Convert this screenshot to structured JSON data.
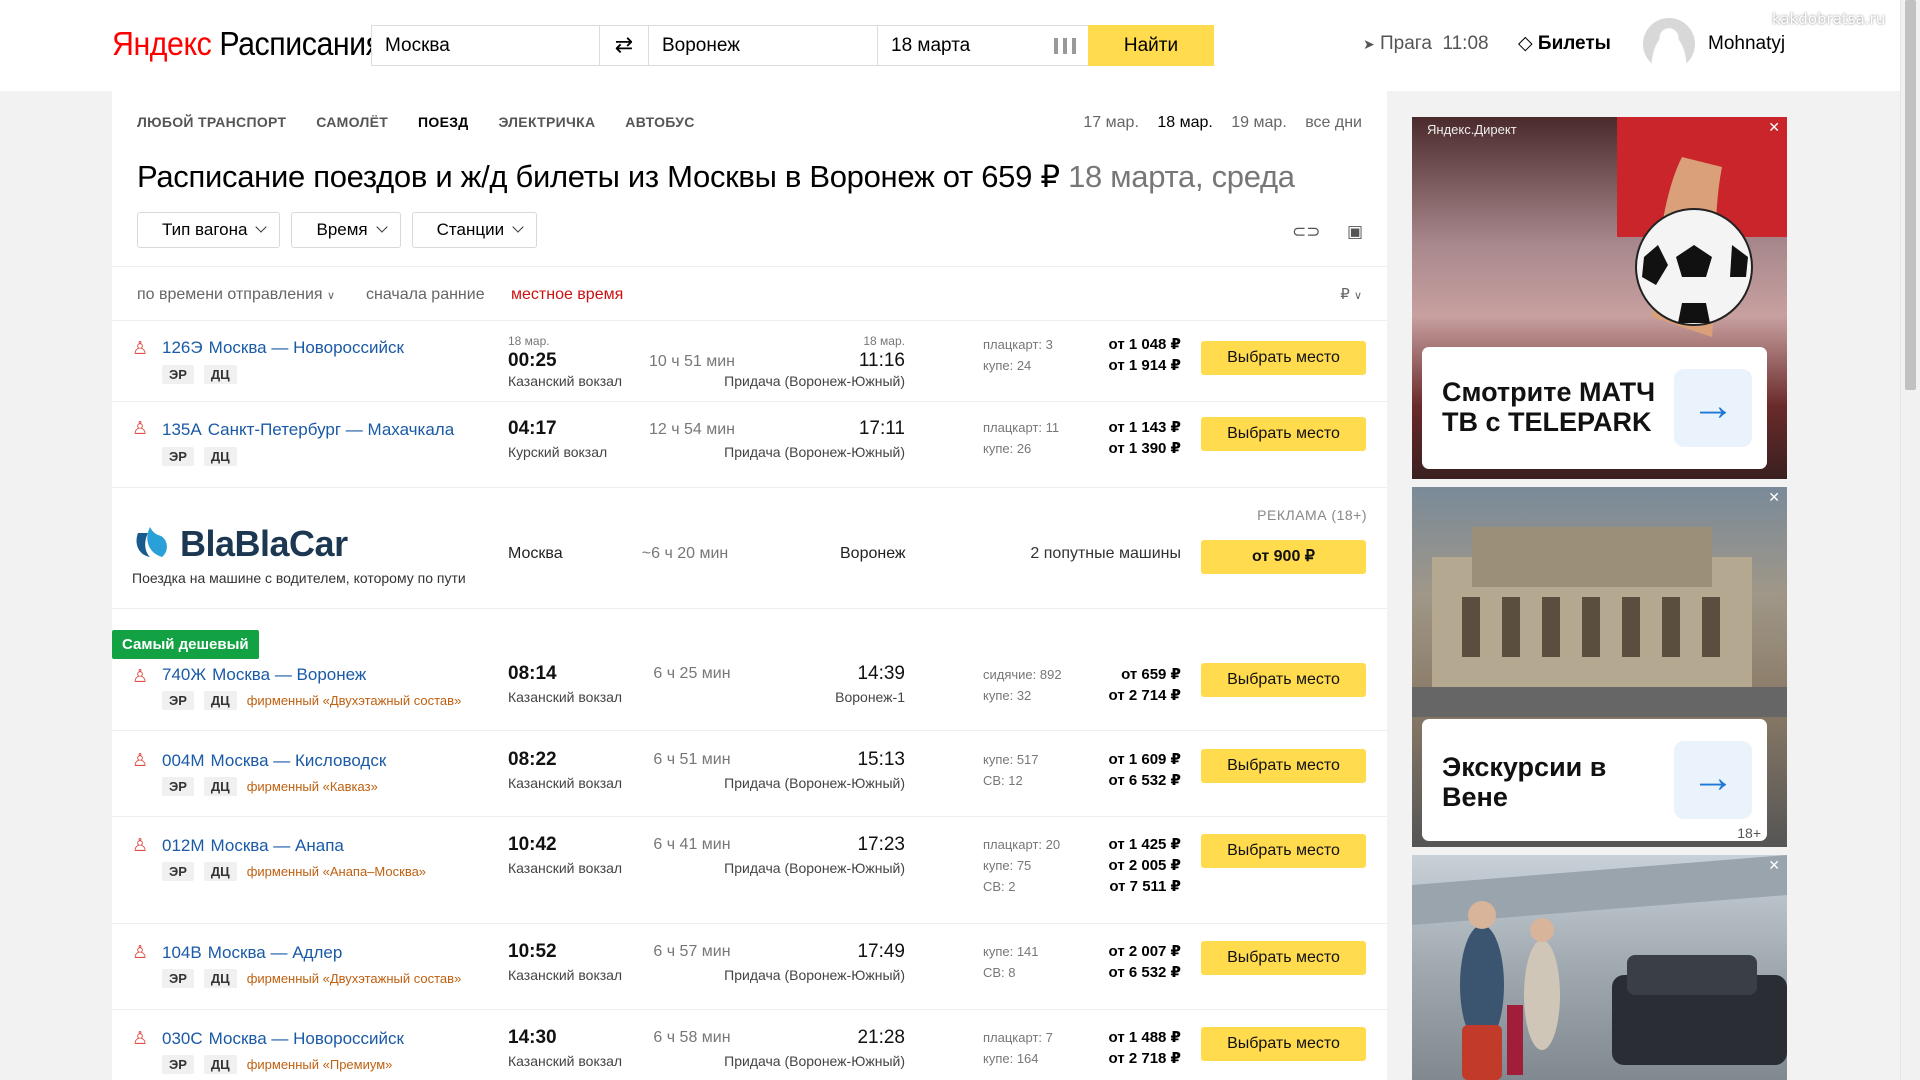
{
  "header": {
    "logo_brand": "Яндекс",
    "logo_service": "Расписания",
    "from_value": "Москва",
    "to_value": "Воронеж",
    "date_value": "18 марта",
    "find_label": "Найти",
    "location": "Прага",
    "time": "11:08",
    "tickets_label": "Билеты",
    "username": "Mohnatyj"
  },
  "watermark": "kakdobratsa.ru",
  "tabs": [
    "ЛЮБОЙ ТРАНСПОРТ",
    "САМОЛЁТ",
    "ПОЕЗД",
    "ЭЛЕКТРИЧКА",
    "АВТОБУС"
  ],
  "active_tab": "ПОЕЗД",
  "dates": [
    "17 мар.",
    "18 мар.",
    "19 мар.",
    "все дни"
  ],
  "title_main": "Расписание поездов и ж/д билеты из Москвы в Воронеж от 659 ₽",
  "title_date": "18 марта, среда",
  "filters": [
    "Тип вагона",
    "Время",
    "Станции"
  ],
  "sort": {
    "by": "по времени отправления",
    "order": "сначала ранние",
    "tz": "местное время",
    "currency": "₽"
  },
  "train_badges": [
    "ЭР",
    "ДЦ"
  ],
  "select_label": "Выбрать место",
  "cheapest_label": "Самый дешевый",
  "trains": [
    {
      "num": "126Э",
      "route": "Москва — Новороссийск",
      "brand": "",
      "dep_date": "18 мар.",
      "dep": "00:25",
      "dep_station": "Казанский вокзал",
      "duration": "10 ч 51 мин",
      "arr_date": "18 мар.",
      "arr": "11:16",
      "arr_station": "Придача (Воронеж-Южный)",
      "classes": [
        "плацкарт: 3",
        "купе: 24"
      ],
      "prices": [
        "от 1 048 ₽",
        "от 1 914 ₽"
      ]
    },
    {
      "num": "135А",
      "route": "Санкт-Петербург — Махачкала",
      "brand": "",
      "dep_date": "",
      "dep": "04:17",
      "dep_station": "Курский вокзал",
      "duration": "12 ч 54 мин",
      "arr_date": "",
      "arr": "17:11",
      "arr_station": "Придача (Воронеж-Южный)",
      "classes": [
        "плацкарт: 11",
        "купе: 26"
      ],
      "prices": [
        "от 1 143 ₽",
        "от 1 390 ₽"
      ]
    },
    {
      "num": "740Ж",
      "route": "Москва — Воронеж",
      "brand": "фирменный «Двухэтажный состав»",
      "dep_date": "",
      "dep": "08:14",
      "dep_station": "Казанский вокзал",
      "duration": "6 ч 25 мин",
      "arr_date": "",
      "arr": "14:39",
      "arr_station": "Воронеж-1",
      "classes": [
        "сидячие: 892",
        "купе: 32"
      ],
      "prices": [
        "от 659 ₽",
        "от 2 714 ₽"
      ]
    },
    {
      "num": "004М",
      "route": "Москва — Кисловодск",
      "brand": "фирменный «Кавказ»",
      "dep_date": "",
      "dep": "08:22",
      "dep_station": "Казанский вокзал",
      "duration": "6 ч 51 мин",
      "arr_date": "",
      "arr": "15:13",
      "arr_station": "Придача (Воронеж-Южный)",
      "classes": [
        "купе: 517",
        "СВ: 12"
      ],
      "prices": [
        "от 1 609 ₽",
        "от 6 532 ₽"
      ]
    },
    {
      "num": "012М",
      "route": "Москва — Анапа",
      "brand": "фирменный «Анапа–Москва»",
      "dep_date": "",
      "dep": "10:42",
      "dep_station": "Казанский вокзал",
      "duration": "6 ч 41 мин",
      "arr_date": "",
      "arr": "17:23",
      "arr_station": "Придача (Воронеж-Южный)",
      "classes": [
        "плацкарт: 20",
        "купе: 75",
        "СВ: 2"
      ],
      "prices": [
        "от 1 425 ₽",
        "от 2 005 ₽",
        "от 7 511 ₽"
      ]
    },
    {
      "num": "104В",
      "route": "Москва — Адлер",
      "brand": "фирменный «Двухэтажный состав»",
      "dep_date": "",
      "dep": "10:52",
      "dep_station": "Казанский вокзал",
      "duration": "6 ч 57 мин",
      "arr_date": "",
      "arr": "17:49",
      "arr_station": "Придача (Воронеж-Южный)",
      "classes": [
        "купе: 141",
        "СВ: 8"
      ],
      "prices": [
        "от 2 007 ₽",
        "от 6 532 ₽"
      ]
    },
    {
      "num": "030С",
      "route": "Москва — Новороссийск",
      "brand": "фирменный «Премиум»",
      "dep_date": "",
      "dep": "14:30",
      "dep_station": "Казанский вокзал",
      "duration": "6 ч 58 мин",
      "arr_date": "",
      "arr": "21:28",
      "arr_station": "Придача (Воронеж-Южный)",
      "classes": [
        "плацкарт: 7",
        "купе: 164"
      ],
      "prices": [
        "от 1 488 ₽",
        "от 2 718 ₽"
      ]
    }
  ],
  "blablacar": {
    "ad_label": "РЕКЛАМА (18+)",
    "logo": "BlaBlaCar",
    "tagline": "Поездка на машине с водителем, которому по пути",
    "from": "Москва",
    "duration": "~6 ч 20 мин",
    "to": "Воронеж",
    "offers": "2 попутные машины",
    "price_label": "от 900 ₽"
  },
  "ads": [
    {
      "label": "Яндекс.Директ",
      "text": "Смотрите МАТЧ ТВ с TELEPARK",
      "age": ""
    },
    {
      "label": "",
      "text": "Экскурсии в Вене",
      "age": "18+"
    },
    {
      "label": "",
      "text": "",
      "age": ""
    }
  ],
  "colors": {
    "accent_yellow": "#ffdb4d",
    "link_blue": "#1a5aa6",
    "cheap_green": "#12a244",
    "brand_red": "#ff0000"
  }
}
